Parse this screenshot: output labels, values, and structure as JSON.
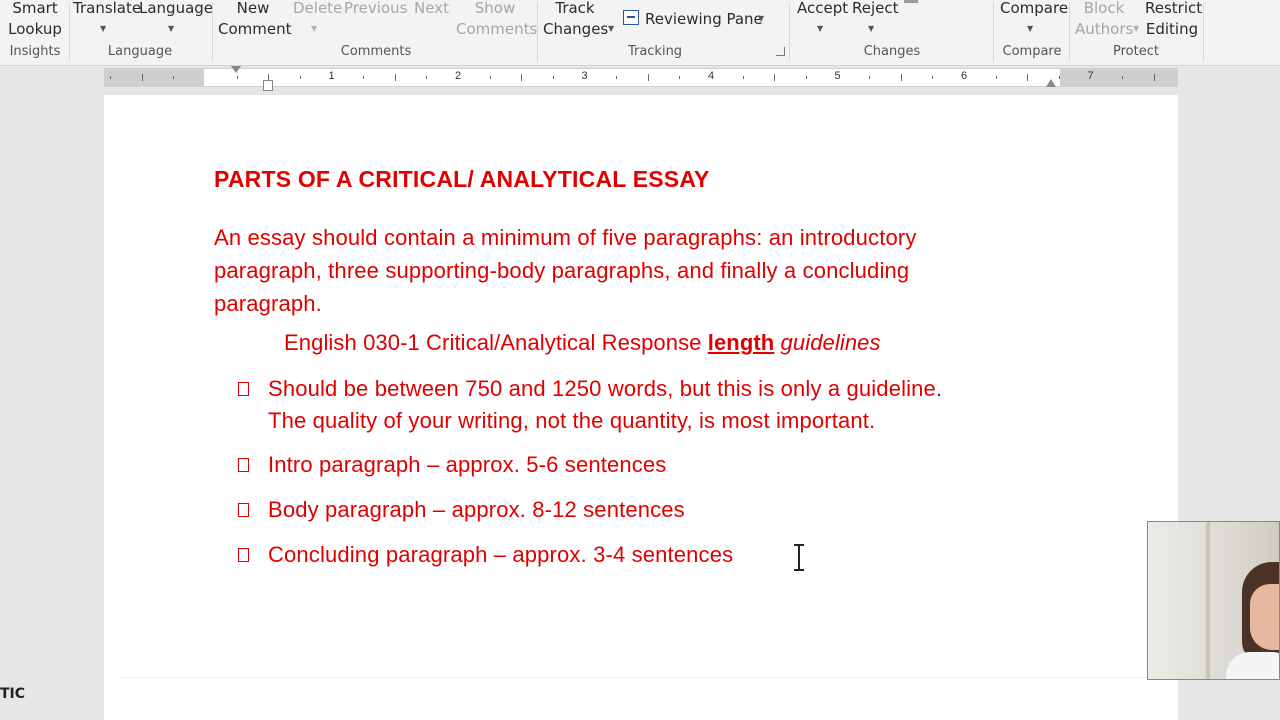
{
  "ribbon": {
    "insights": {
      "smart_lookup": "Smart\nLookup",
      "group": "Insights"
    },
    "language": {
      "translate": "Translate",
      "language": "Language",
      "group": "Language"
    },
    "comments": {
      "new_comment": "New\nComment",
      "delete": "Delete",
      "previous": "Previous",
      "next": "Next",
      "show_comments": "Show\nComments",
      "group": "Comments"
    },
    "tracking": {
      "track_changes": "Track\nChanges",
      "reviewing_pane": "Reviewing Pane",
      "group": "Tracking"
    },
    "changes": {
      "accept": "Accept",
      "reject": "Reject",
      "group": "Changes"
    },
    "compare": {
      "compare": "Compare",
      "group": "Compare"
    },
    "protect": {
      "block_authors": "Block\nAuthors",
      "restrict_editing": "Restrict\nEditing",
      "group": "Protect"
    }
  },
  "ruler": {
    "numbers": [
      "1",
      "2",
      "3",
      "4",
      "5",
      "6",
      "7"
    ]
  },
  "document": {
    "heading": "PARTS OF A CRITICAL/ ANALYTICAL ESSAY",
    "intro": "An essay should contain a minimum of five paragraphs: an introductory paragraph, three supporting-body paragraphs, and finally a concluding paragraph.",
    "subtitle": {
      "pre": "English 030-1 Critical/Analytical Response ",
      "underlined": "length",
      "italic": "guidelines"
    },
    "bullets": [
      {
        "line1": "Should be between 750 and 1250 words, but this is only a guideline.",
        "line2": "The quality of your writing, not the quantity, is most important."
      },
      {
        "line1": "Intro paragraph – approx. 5-6 sentences"
      },
      {
        "line1": "Body paragraph – approx. 8-12 sentences"
      },
      {
        "line1": "Concluding paragraph – approx. 3-4 sentences"
      }
    ],
    "text_color": "#e00000"
  },
  "overlay": {
    "corner_text": "TIC"
  }
}
